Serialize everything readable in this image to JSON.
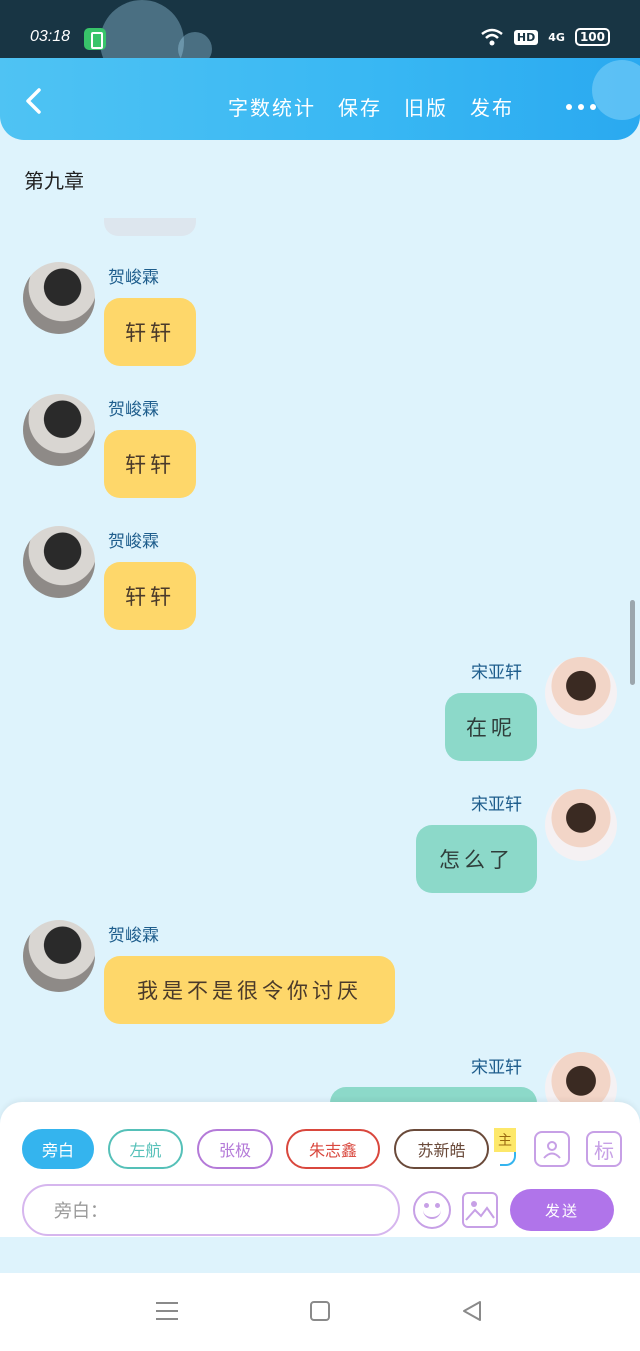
{
  "status_bar": {
    "time": "03:18",
    "network": "4G",
    "hd": "HD",
    "battery": "100"
  },
  "header": {
    "back_icon": "chevron-left-icon",
    "menu": [
      "字数统计",
      "保存",
      "旧版",
      "发布"
    ],
    "more_icon": "more-dots-icon"
  },
  "chapter_title": "第九章",
  "messages": [
    {
      "side": "left",
      "name": "贺峻霖",
      "text": "轩轩"
    },
    {
      "side": "left",
      "name": "贺峻霖",
      "text": "轩轩"
    },
    {
      "side": "left",
      "name": "贺峻霖",
      "text": "轩轩"
    },
    {
      "side": "right",
      "name": "宋亚轩",
      "text": "在呢"
    },
    {
      "side": "right",
      "name": "宋亚轩",
      "text": "怎么了"
    },
    {
      "side": "left",
      "name": "贺峻霖",
      "text": "我是不是很令你讨厌"
    },
    {
      "side": "right",
      "name": "宋亚轩",
      "text": ""
    }
  ],
  "characters": [
    {
      "label": "旁白",
      "color": "#34b4ee",
      "active": true
    },
    {
      "label": "左航",
      "color": "#55c0b8",
      "active": false
    },
    {
      "label": "张极",
      "color": "#b47ad8",
      "active": false
    },
    {
      "label": "朱志鑫",
      "color": "#d9473d",
      "active": false
    },
    {
      "label": "苏新皓",
      "color": "#6a4a3a",
      "active": false
    }
  ],
  "main_tag": "主",
  "tag_button": "标",
  "input": {
    "placeholder": "旁白："
  },
  "send_label": "发送",
  "colors": {
    "header": "#38b7f3",
    "left_bubble": "#fed76a",
    "right_bubble": "#8cd9c9",
    "send": "#b074ea",
    "background": "#def3fc"
  }
}
